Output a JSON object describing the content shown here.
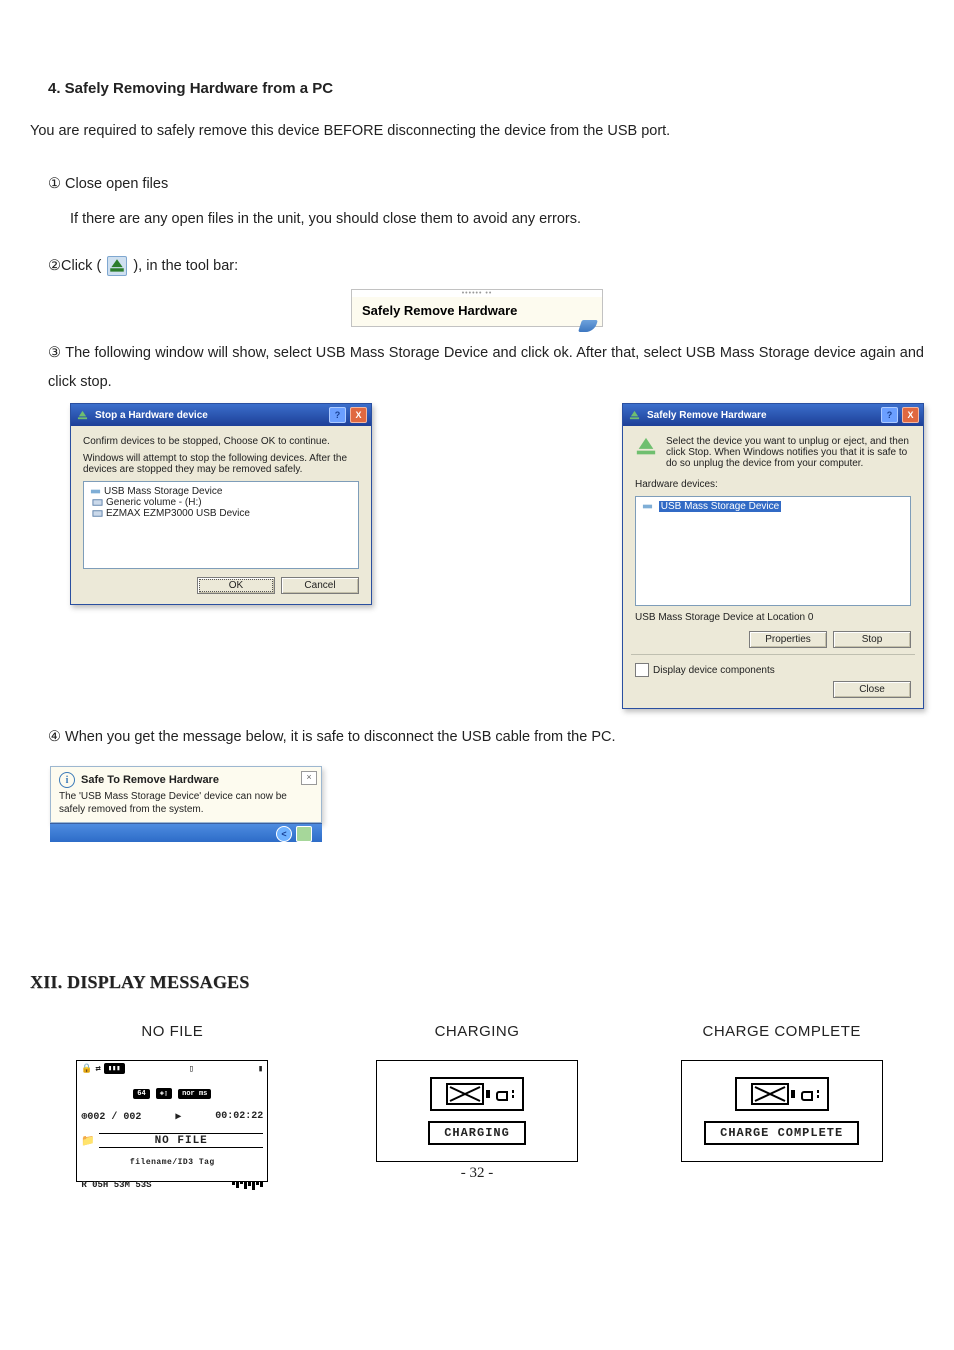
{
  "section_heading": "4.  Safely Removing Hardware from a PC",
  "intro_text": "You are required to safely remove this device BEFORE disconnecting the device from the USB port.",
  "step1_title": "① Close open files",
  "step1_body": "If there are any open files in the unit, you should close them to avoid any errors.",
  "step2_a": "②Click (",
  "step2_b": "), in the tool bar:",
  "tooltip_label": "Safely Remove Hardware",
  "step3": "③ The following window will show, select USB Mass Storage Device and click ok. After that, select USB Mass Storage device again and click stop.",
  "dlg_stop": {
    "title": "Stop a Hardware device",
    "line1": "Confirm devices to be stopped, Choose OK to continue.",
    "line2": "Windows will attempt to stop the following devices. After the devices are stopped they may be removed safely.",
    "item1": "USB Mass Storage Device",
    "item2": "Generic volume - (H:)",
    "item3": "EZMAX EZMP3000 USB Device",
    "ok": "OK",
    "cancel": "Cancel"
  },
  "dlg_safe": {
    "title": "Safely Remove Hardware",
    "instr": "Select the device you want to unplug or eject, and then click Stop. When Windows notifies you that it is safe to do so unplug the device from your computer.",
    "hw_label": "Hardware devices:",
    "item": "USB Mass Storage Device",
    "status": "USB Mass Storage Device at Location 0",
    "properties": "Properties",
    "stop": "Stop",
    "checkbox": "Display device components",
    "close": "Close"
  },
  "step4": "④ When you get the message below, it is safe to disconnect the USB cable from the PC.",
  "balloon": {
    "title": "Safe To Remove Hardware",
    "body": "The 'USB Mass Storage Device' device can now be safely removed from the system."
  },
  "section_xii": "XII. DISPLAY MESSAGES",
  "cols": {
    "no_file": "NO FILE",
    "charging": "CHARGING",
    "complete": "CHARGE COMPLETE"
  },
  "lcd_nofile": {
    "counter": "⊕002 / 002",
    "time": "00:02:22",
    "text": "NO FILE",
    "tag": "filename/ID3 Tag",
    "bottom": "R 05H 53M 53S"
  },
  "lcd_charging": "CHARGING",
  "lcd_complete": "CHARGE COMPLETE",
  "page_number": "- 32 -"
}
